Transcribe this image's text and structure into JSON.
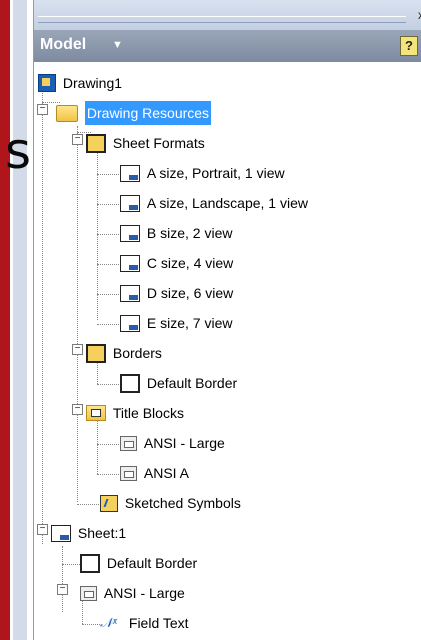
{
  "panel_header": {
    "title": "Model",
    "help": "?"
  },
  "topbar": {
    "close": "x"
  },
  "background_glyph": "s",
  "tree": {
    "root": "Drawing1",
    "drawing_resources": "Drawing Resources",
    "sheet_formats": "Sheet Formats",
    "sheet_format_items": [
      "A size, Portrait, 1 view",
      "A size, Landscape, 1 view",
      "B size, 2 view",
      "C size, 4 view",
      "D size, 6 view",
      "E size, 7 view"
    ],
    "borders": "Borders",
    "border_items": [
      "Default Border"
    ],
    "title_blocks": "Title Blocks",
    "title_block_items": [
      "ANSI - Large",
      "ANSI A"
    ],
    "sketched_symbols": "Sketched Symbols",
    "sheet": "Sheet:1",
    "sheet_children": [
      "Default Border",
      "ANSI - Large"
    ],
    "field_text": "Field Text"
  }
}
